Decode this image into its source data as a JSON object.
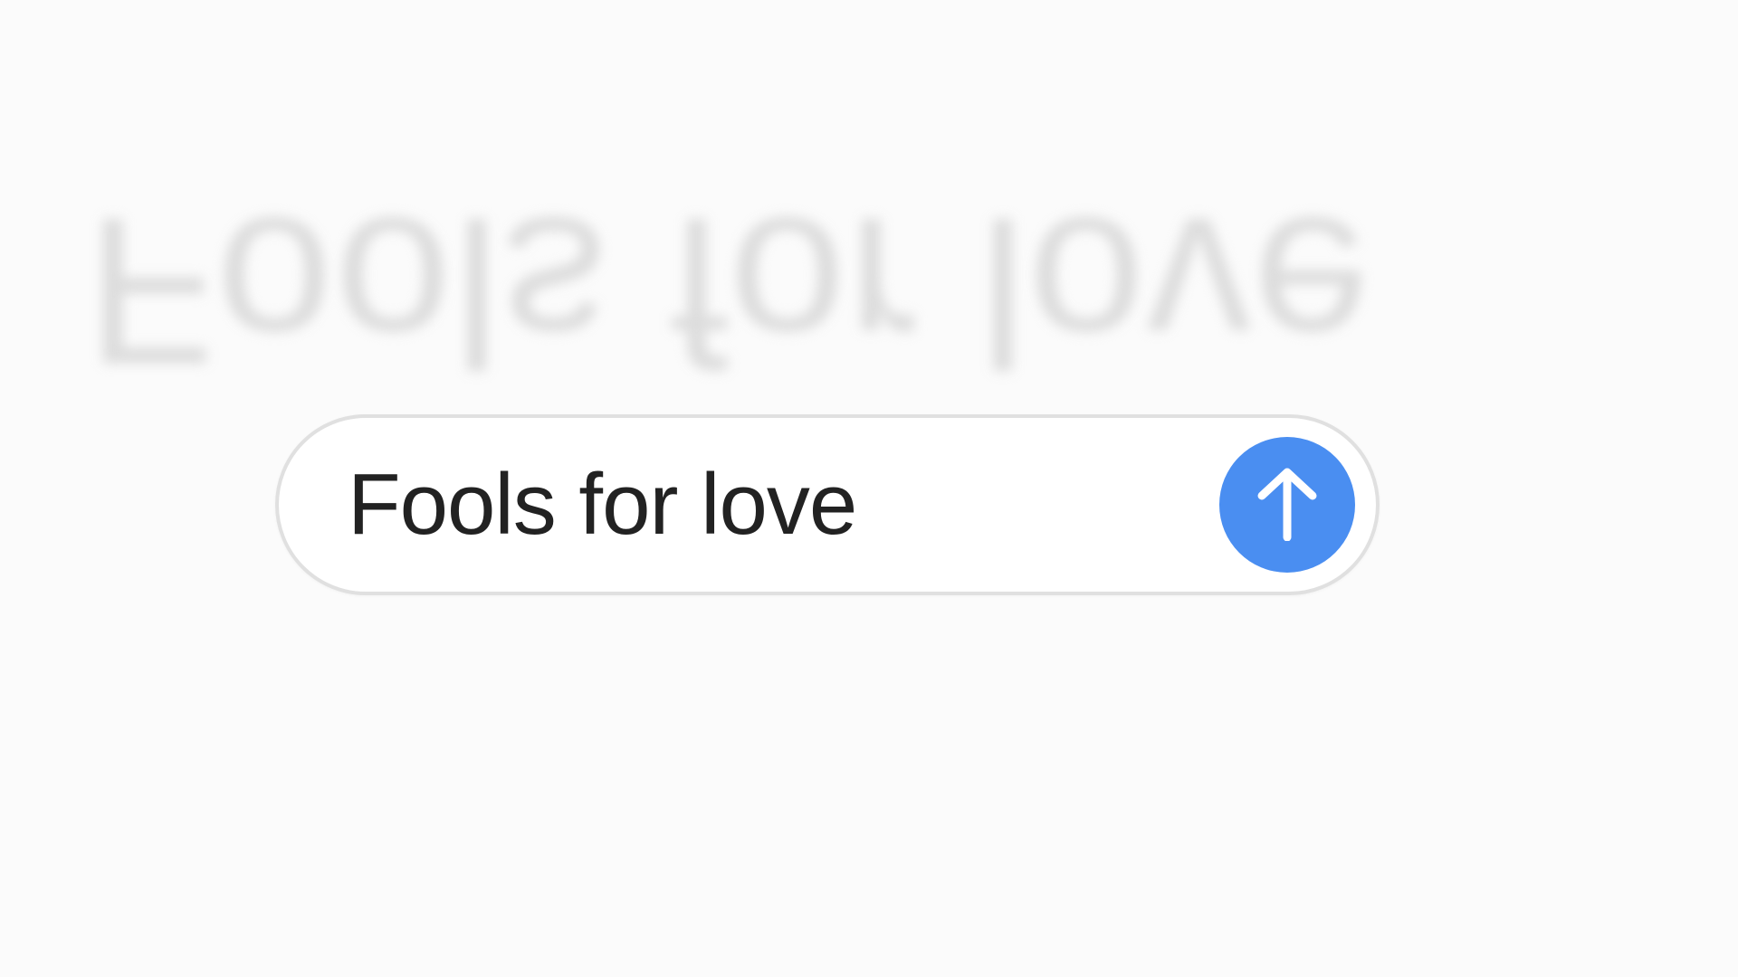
{
  "reflection": {
    "text": "Fools for love"
  },
  "search": {
    "value": "Fools for love"
  },
  "submit": {
    "icon": "arrow-up-icon",
    "color": "#4a8ef1"
  }
}
